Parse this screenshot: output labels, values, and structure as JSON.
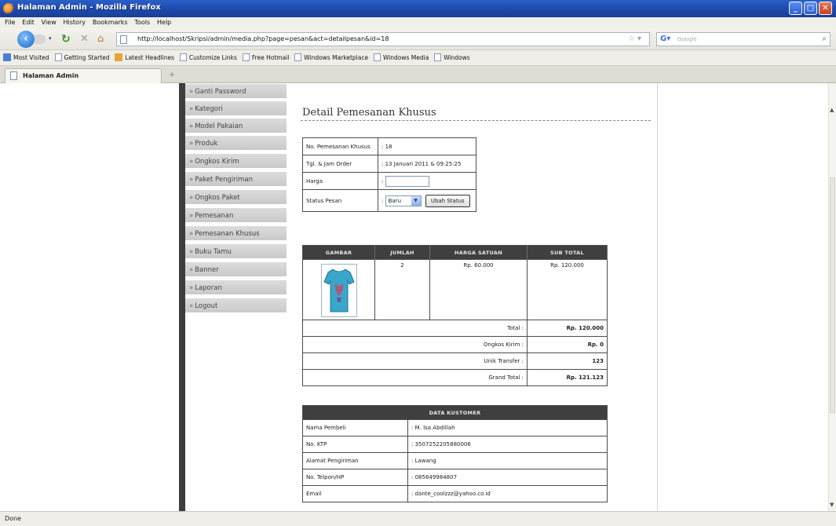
{
  "window": {
    "title": "Halaman Admin - Mozilla Firefox"
  },
  "menu": [
    "File",
    "Edit",
    "View",
    "History",
    "Bookmarks",
    "Tools",
    "Help"
  ],
  "navigation": {
    "url": "http://localhost/Skripsi/admin/media.php?page=pesan&act=detailpesan&id=18",
    "search_placeholder": "Google"
  },
  "bookmarks": [
    "Most Visited",
    "Getting Started",
    "Latest Headlines",
    "Customize Links",
    "Free Hotmail",
    "Windows Marketplace",
    "Windows Media",
    "Windows"
  ],
  "tab": {
    "label": "Halaman Admin"
  },
  "status": "Done",
  "sidebar": {
    "arrow": "»",
    "items": [
      "Ganti Password",
      "Kategori",
      "Model Pakaian",
      "Produk",
      "Ongkos Kirim",
      "Paket Pengiriman",
      "Ongkos Paket",
      "Pemesanan",
      "Pemesanan Khusus",
      "Buku Tamu",
      "Banner",
      "Laporan",
      "Logout"
    ]
  },
  "detail": {
    "title": "Detail Pemesanan Khusus",
    "info": {
      "order_no_label": "No. Pemesanan Khusus",
      "order_no_value": ": 18",
      "date_label": "Tgl. & Jam Order",
      "date_value": ": 13 Januari 2011 & 09:25:25",
      "price_label": "Harga",
      "price_prefix": ":",
      "status_label": "Status Pesan",
      "status_prefix": ":",
      "status_value": "Baru",
      "change_status_button": "Ubah Status"
    },
    "order_table": {
      "headers": [
        "GAMBAR",
        "JUMLAH",
        "HARGA SATUAN",
        "SUB TOTAL"
      ],
      "item": {
        "qty": "2",
        "unit_price": "Rp. 60.000",
        "subtotal": "Rp. 120.000"
      },
      "summary": [
        {
          "label": "Total :",
          "value": "Rp. 120.000"
        },
        {
          "label": "Ongkos Kirim :",
          "value": "Rp. 0"
        },
        {
          "label": "Unik Transfer :",
          "value": "123"
        },
        {
          "label": "Grand Total :",
          "value": "Rp. 121.123"
        }
      ]
    },
    "customer_table": {
      "header": "DATA KUSTOMER",
      "rows": [
        {
          "label": "Nama Pembeli",
          "value": ": M. Isa Abdillah"
        },
        {
          "label": "No. KTP",
          "value": ": 3507252205880006"
        },
        {
          "label": "Alamat Pengiriman",
          "value": ": Lawang"
        },
        {
          "label": "No. Telpon/HP",
          "value": ": 085649984807"
        },
        {
          "label": "Email",
          "value": ": dante_coolzzz@yahoo.co.id"
        }
      ]
    }
  }
}
